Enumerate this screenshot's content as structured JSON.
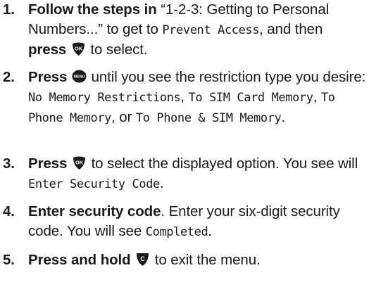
{
  "steps": [
    {
      "number": "1.",
      "bold_lead": "Follow the steps in",
      "text_a": " “1-2-3: Getting to Personal Numbers...” to get to ",
      "lcd_a": "Prevent Access",
      "text_b": ", and then ",
      "bold_b": "press",
      "icon": "ok-button-icon",
      "text_c": " to  select."
    },
    {
      "number": "2.",
      "bold_lead": "Press",
      "icon": "menu-button-icon",
      "icon_label": "MENU",
      "text_a": " until you see the restriction type you desire: ",
      "lcd_a": "No Memory Restrictions",
      "text_b": ", ",
      "lcd_b": "To SIM Card Memory",
      "text_c": ", ",
      "lcd_c": "To Phone Memory",
      "text_d": ", or ",
      "lcd_d": "To Phone & SIM Memory",
      "text_e": "."
    },
    {
      "number": "3.",
      "bold_lead": "Press",
      "icon": "ok-button-icon",
      "text_a": " to select the displayed option. You see will ",
      "lcd_a": "Enter Security Code",
      "text_b": "."
    },
    {
      "number": "4.",
      "bold_lead": "Enter security code",
      "text_a": ". Enter your six-digit security code. You will see ",
      "lcd_a": "Completed",
      "text_b": "."
    },
    {
      "number": "5.",
      "bold_lead": "Press and hold",
      "icon": "clear-button-icon",
      "text_a": " to exit the menu."
    }
  ],
  "icons": {
    "ok_label": "OK",
    "menu_label": "MENU",
    "clear_label": "C"
  },
  "colors": {
    "text": "#1a1a1a",
    "icon_fill": "#1a1a1a",
    "icon_text": "#ffffff"
  }
}
